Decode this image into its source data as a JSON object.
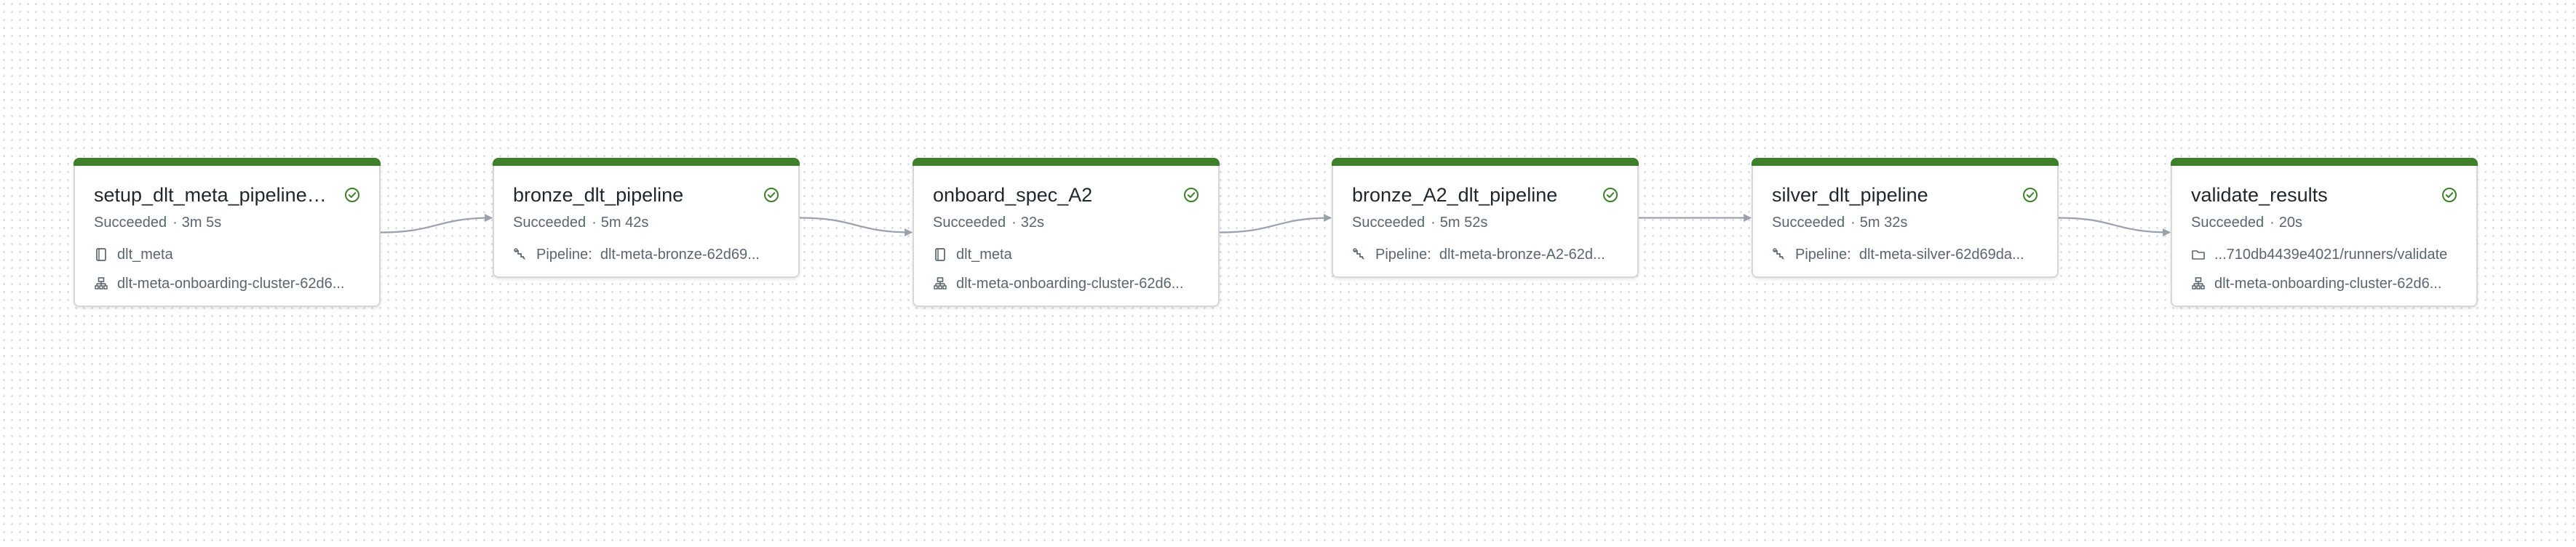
{
  "colors": {
    "success_bar": "#3d7f2a",
    "success_icon": "#3d7f2a",
    "edge": "#9aa3ad",
    "card_border": "#d4d8dd",
    "muted_text": "#5a6570"
  },
  "tasks": [
    {
      "name": "setup_dlt_meta_pipeline_...",
      "status": "Succeeded",
      "duration": "3m 5s",
      "status_icon": "check-circle-icon",
      "details": [
        {
          "icon": "notebook-icon",
          "text": "dlt_meta"
        },
        {
          "icon": "cluster-icon",
          "text": "dlt-meta-onboarding-cluster-62d6..."
        }
      ]
    },
    {
      "name": "bronze_dlt_pipeline",
      "status": "Succeeded",
      "duration": "5m 42s",
      "status_icon": "check-circle-icon",
      "details": [
        {
          "icon": "pipeline-icon",
          "label": "Pipeline:",
          "text": "dlt-meta-bronze-62d69..."
        }
      ]
    },
    {
      "name": "onboard_spec_A2",
      "status": "Succeeded",
      "duration": "32s",
      "status_icon": "check-circle-icon",
      "details": [
        {
          "icon": "notebook-icon",
          "text": "dlt_meta"
        },
        {
          "icon": "cluster-icon",
          "text": "dlt-meta-onboarding-cluster-62d6..."
        }
      ]
    },
    {
      "name": "bronze_A2_dlt_pipeline",
      "status": "Succeeded",
      "duration": "5m 52s",
      "status_icon": "check-circle-icon",
      "details": [
        {
          "icon": "pipeline-icon",
          "label": "Pipeline:",
          "text": "dlt-meta-bronze-A2-62d..."
        }
      ]
    },
    {
      "name": "silver_dlt_pipeline",
      "status": "Succeeded",
      "duration": "5m 32s",
      "status_icon": "check-circle-icon",
      "details": [
        {
          "icon": "pipeline-icon",
          "label": "Pipeline:",
          "text": "dlt-meta-silver-62d69da..."
        }
      ]
    },
    {
      "name": "validate_results",
      "status": "Succeeded",
      "duration": "20s",
      "status_icon": "check-circle-icon",
      "details": [
        {
          "icon": "folder-icon",
          "text": "...710db4439e4021/runners/validate"
        },
        {
          "icon": "cluster-icon",
          "text": "dlt-meta-onboarding-cluster-62d6..."
        }
      ]
    }
  ]
}
